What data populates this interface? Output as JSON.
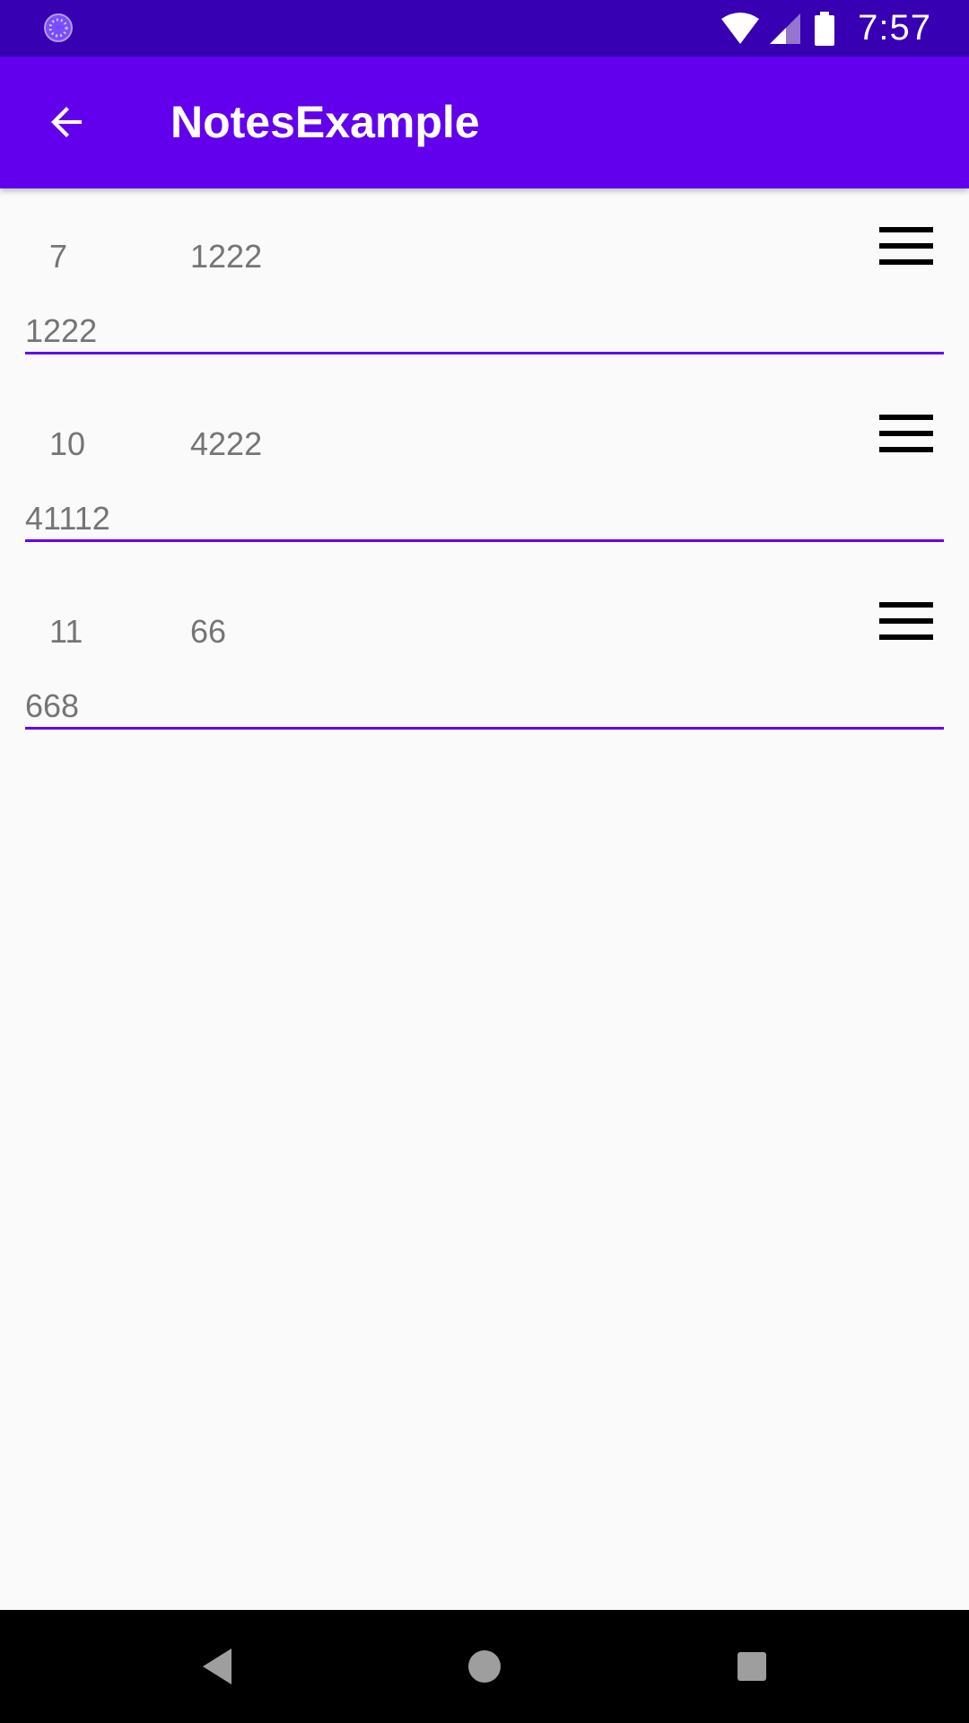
{
  "status_bar": {
    "time": "7:57",
    "icons": [
      "loading-icon",
      "wifi-icon",
      "cellular-icon",
      "battery-icon"
    ],
    "background": "#3700B3"
  },
  "app_bar": {
    "title": "NotesExample",
    "back_icon": "arrow-back-icon",
    "background": "#6200EE"
  },
  "notes": [
    {
      "id": "7",
      "title": "1222",
      "body": "1222"
    },
    {
      "id": "10",
      "title": "4222",
      "body": "41112"
    },
    {
      "id": "11",
      "title": "66",
      "body": "668"
    }
  ],
  "nav_bar": {
    "icons": [
      "back-nav-icon",
      "home-nav-icon",
      "recents-nav-icon"
    ]
  }
}
